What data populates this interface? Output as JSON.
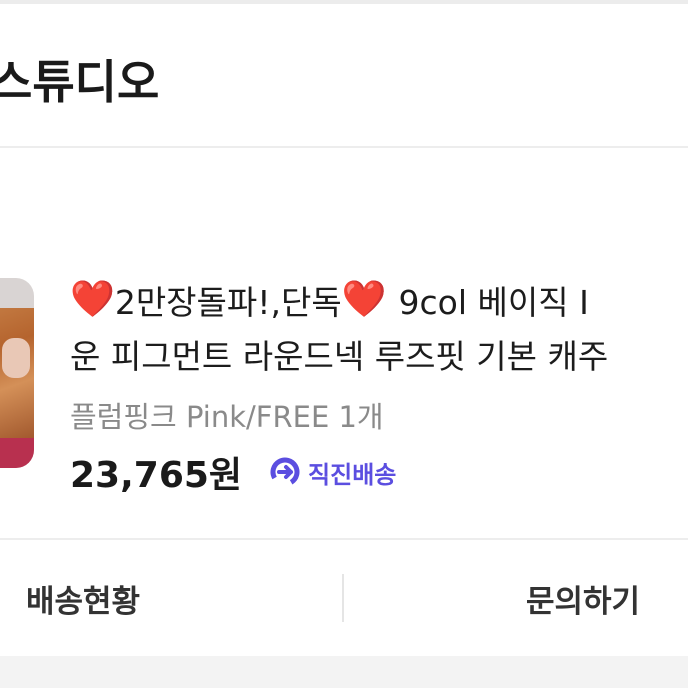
{
  "store": {
    "name": "스튜디오"
  },
  "product": {
    "title_line1": {
      "heart": "❤️",
      "part_a": "2만장돌파!,단독",
      "part_b": "9col 베이직 I"
    },
    "title_line2": "운 피그먼트 라운드넥 루즈핏 기본 캐주",
    "option": "플럼핑크 Pink/FREE 1개",
    "price": "23,765원",
    "shipping": {
      "label": "직진배송",
      "icon": "arrow-circle-icon",
      "color": "#5b4ee0"
    }
  },
  "actions": {
    "left_label": "배송현황",
    "right_label": "문의하기"
  },
  "colors": {
    "heart": "#d8232a",
    "accent": "#5b4ee0"
  }
}
